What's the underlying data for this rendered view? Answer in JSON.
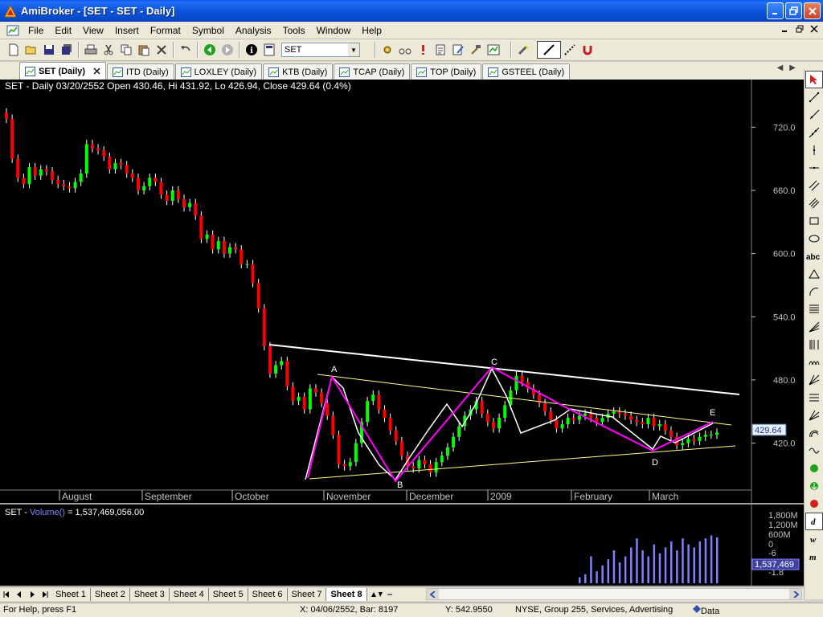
{
  "window": {
    "title": "AmiBroker - [SET - SET - Daily]"
  },
  "menu": {
    "items": [
      "File",
      "Edit",
      "View",
      "Insert",
      "Format",
      "Symbol",
      "Analysis",
      "Tools",
      "Window",
      "Help"
    ]
  },
  "toolbar": {
    "symbol": "SET"
  },
  "tabs": [
    {
      "label": "SET (Daily)",
      "active": true
    },
    {
      "label": "ITD (Daily)",
      "active": false
    },
    {
      "label": "LOXLEY (Daily)",
      "active": false
    },
    {
      "label": "KTB (Daily)",
      "active": false
    },
    {
      "label": "TCAP (Daily)",
      "active": false
    },
    {
      "label": "TOP (Daily)",
      "active": false
    },
    {
      "label": "GSTEEL (Daily)",
      "active": false
    }
  ],
  "chart": {
    "header": "SET - Daily 03/20/2552 Open 430.46, Hi 431.92, Lo 426.94, Close 429.64 (0.4%)",
    "price_label": "429.64",
    "volume_header_symbol": "SET - ",
    "volume_header_func": "Volume()",
    "volume_header_value": " = 1,537,469,056.00",
    "volume_label": "1,537,469",
    "volume_ticks": [
      "1,800M",
      "1,200M",
      "600M",
      "0",
      "-6",
      "-1.8"
    ],
    "wave_labels": [
      "A",
      "B",
      "C",
      "D",
      "E"
    ]
  },
  "chart_data": {
    "type": "candlestick",
    "x_labels": [
      "August",
      "September",
      "October",
      "November",
      "December",
      "2009",
      "February",
      "March"
    ],
    "y_ticks": [
      720.0,
      660.0,
      600.0,
      540.0,
      480.0,
      420.0
    ],
    "ylim": [
      380,
      750
    ],
    "colors": {
      "up": "#00ff00",
      "down": "#ff0000",
      "axis": "#c0c0c0",
      "trend": "#ffffff",
      "wave": "#ff00ff",
      "channel": "#ffff80"
    },
    "closes": [
      728,
      690,
      672,
      666,
      682,
      674,
      680,
      678,
      670,
      666,
      664,
      662,
      668,
      676,
      704,
      700,
      698,
      692,
      680,
      686,
      684,
      676,
      672,
      660,
      664,
      672,
      668,
      656,
      650,
      660,
      652,
      644,
      648,
      636,
      614,
      618,
      604,
      612,
      600,
      606,
      604,
      590,
      590,
      572,
      548,
      512,
      486,
      494,
      498,
      474,
      460,
      464,
      452,
      472,
      468,
      458,
      446,
      428,
      400,
      398,
      402,
      420,
      440,
      460,
      466,
      452,
      444,
      432,
      422,
      408,
      398,
      396,
      404,
      400,
      392,
      402,
      408,
      416,
      426,
      436,
      446,
      452,
      460,
      448,
      440,
      434,
      444,
      456,
      470,
      484,
      478,
      472,
      466,
      458,
      450,
      442,
      434,
      438,
      444,
      442,
      446,
      448,
      444,
      440,
      444,
      448,
      450,
      448,
      446,
      442,
      440,
      438,
      444,
      436,
      438,
      432,
      426,
      418,
      420,
      424,
      422,
      426,
      428,
      428,
      430
    ],
    "volume": [
      0,
      0,
      0,
      0,
      0,
      0,
      0,
      0,
      0,
      0,
      0,
      0,
      0,
      0,
      0,
      0,
      0,
      0,
      0,
      0,
      0,
      0,
      0,
      0,
      0,
      0,
      0,
      0,
      0,
      0,
      0,
      0,
      0,
      0,
      0,
      0,
      0,
      0,
      0,
      0,
      0,
      0,
      0,
      0,
      0,
      0,
      0,
      0,
      0,
      0,
      0,
      0,
      0,
      0,
      0,
      0,
      0,
      0,
      0,
      0,
      0,
      0,
      0,
      0,
      0,
      0,
      0,
      0,
      0,
      0,
      0,
      0,
      0,
      0,
      0,
      0,
      0,
      0,
      0,
      0,
      0,
      0,
      0,
      0,
      0,
      0,
      0,
      0,
      0,
      0,
      0,
      0,
      0,
      0,
      0,
      0,
      0,
      0,
      0,
      0,
      200,
      300,
      900,
      400,
      600,
      800,
      1100,
      700,
      900,
      1200,
      1500,
      1100,
      900,
      1300,
      1000,
      1200,
      1400,
      1100,
      1500,
      1300,
      1200,
      1400,
      1500,
      1600,
      1537
    ],
    "volume_ylim": [
      0,
      1800
    ]
  },
  "sheets": [
    "Sheet 1",
    "Sheet 2",
    "Sheet 3",
    "Sheet 4",
    "Sheet 5",
    "Sheet 6",
    "Sheet 7",
    "Sheet 8"
  ],
  "active_sheet": "Sheet 8",
  "status": {
    "help": "For Help, press F1",
    "xy": "X: 04/06/2552, Bar: 8197",
    "y": "Y: 542.9550",
    "market": "NYSE, Group 255, Services, Advertising",
    "data": "Data"
  }
}
